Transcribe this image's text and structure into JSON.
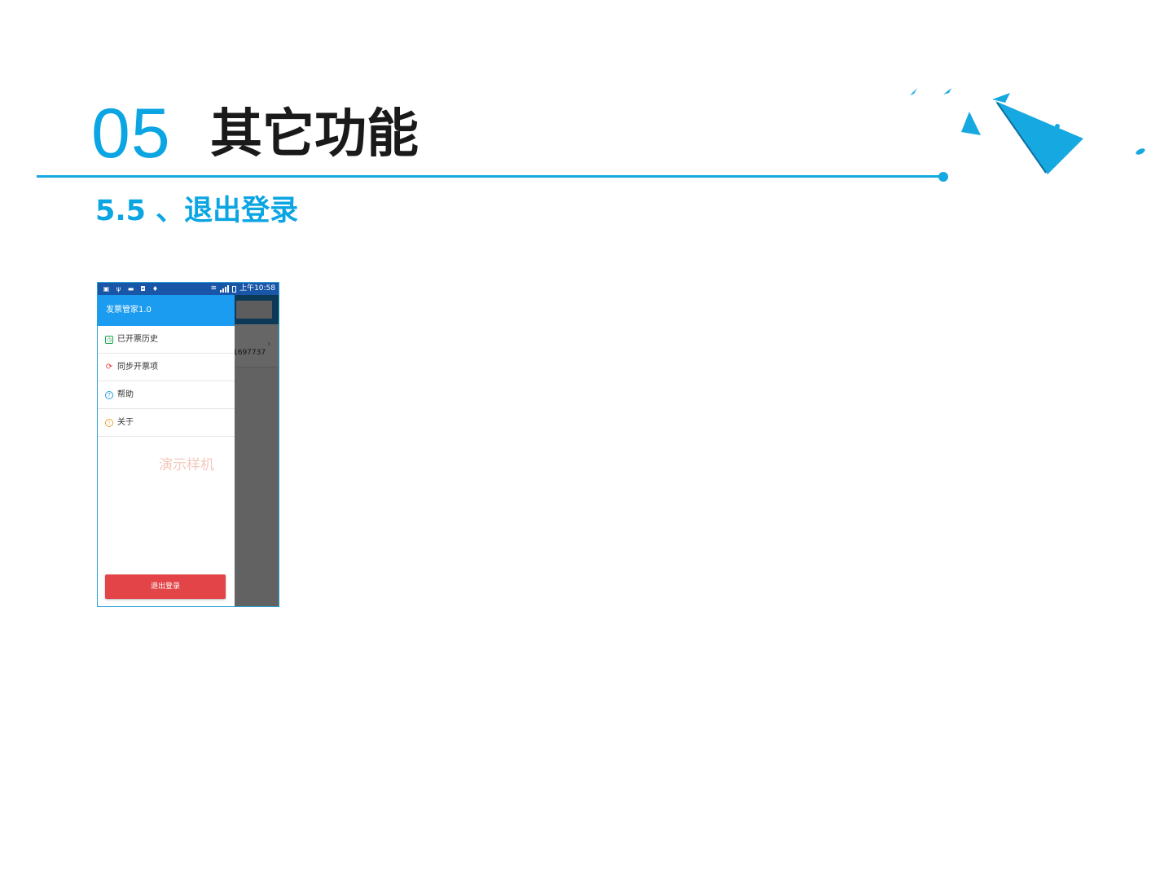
{
  "slide": {
    "section_number": "05",
    "section_title": "其它功能",
    "subtitle": "5.5 、退出登录",
    "accent_color": "#0aa5e2"
  },
  "phone": {
    "status_bar": {
      "icons": [
        "notification-icon",
        "usb-icon",
        "image-icon",
        "shield-icon",
        "location-icon",
        "wifi-icon",
        "signal-icon",
        "battery-icon"
      ],
      "time": "上午10:58"
    },
    "background_screen": {
      "row_code": "1697737"
    },
    "drawer": {
      "header_title": "发票管家1.0",
      "items": [
        {
          "label": "已开票历史",
          "icon": "invoice-history-icon"
        },
        {
          "label": "同步开票项",
          "icon": "sync-icon"
        },
        {
          "label": "帮助",
          "icon": "help-icon"
        },
        {
          "label": "关于",
          "icon": "info-icon"
        }
      ],
      "watermark": "演示样机",
      "logout_label": "退出登录",
      "logout_color": "#e24447",
      "header_color": "#1b9cf0"
    }
  }
}
